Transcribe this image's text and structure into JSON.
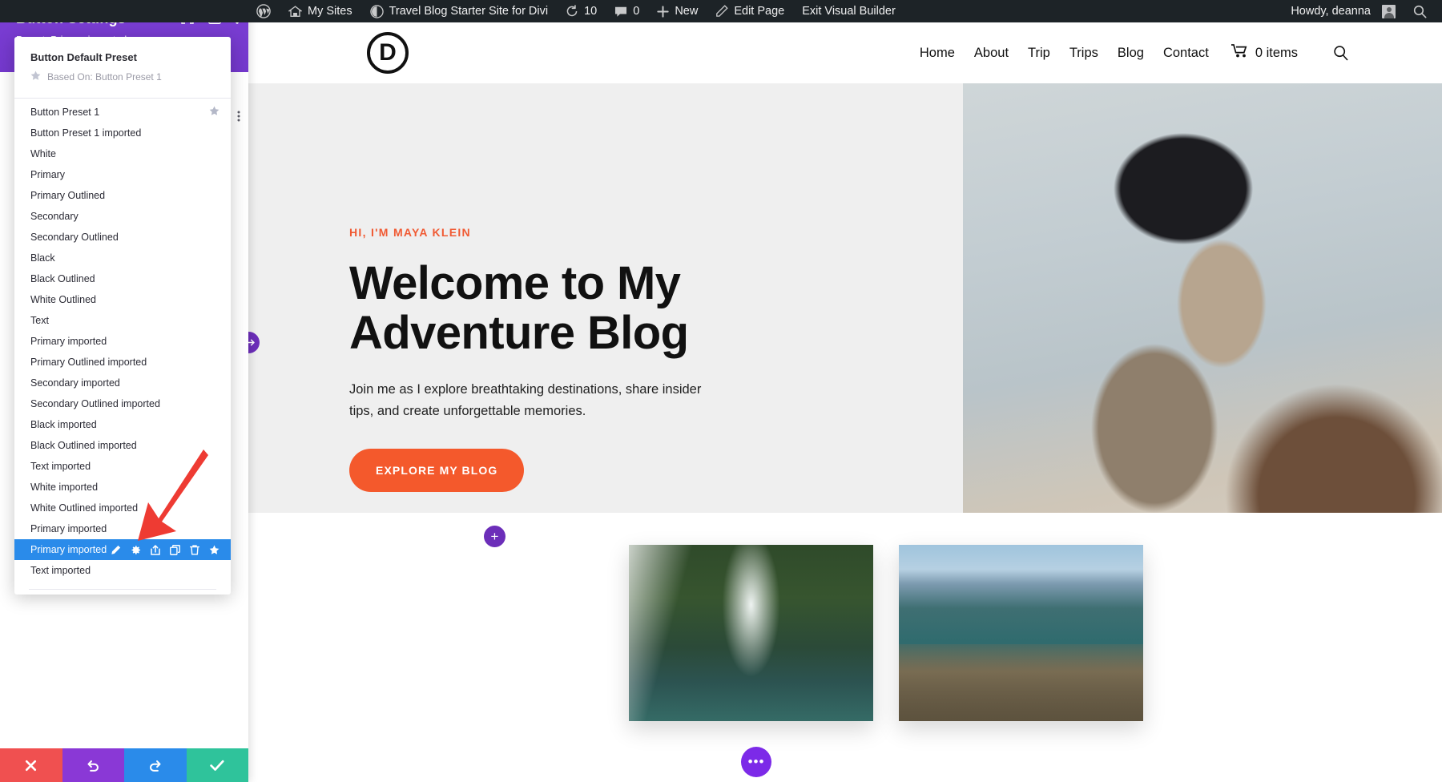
{
  "admin_bar": {
    "items": [
      {
        "name": "wp-logo",
        "label": "",
        "icon": "wordpress-icon"
      },
      {
        "name": "my-sites",
        "label": "My Sites",
        "icon": "sites-icon"
      },
      {
        "name": "site-name",
        "label": "Travel Blog Starter Site for Divi",
        "icon": "dashboard-icon"
      },
      {
        "name": "updates",
        "label": "10",
        "icon": "updates-icon"
      },
      {
        "name": "comments",
        "label": "0",
        "icon": "comment-icon"
      },
      {
        "name": "new-content",
        "label": "New",
        "icon": "plus-icon"
      },
      {
        "name": "edit-page",
        "label": "Edit Page",
        "icon": "pencil-icon"
      },
      {
        "name": "exit-visual-builder",
        "label": "Exit Visual Builder",
        "icon": ""
      }
    ],
    "howdy": "Howdy, deanna",
    "search_icon": "search-icon"
  },
  "builder": {
    "title": "Button Settings",
    "preset_label": "Preset: Primary imported",
    "header_icons": [
      "focus-icon",
      "layout-panel-icon",
      "more-vertical-icon"
    ],
    "footer": {
      "cancel": "cancel-icon",
      "undo": "undo-icon",
      "redo": "redo-icon",
      "save": "check-icon"
    },
    "accent_purple": "#7b3fd1",
    "accent_blue": "#2a8bea"
  },
  "preset_menu": {
    "default_title": "Button Default Preset",
    "default_sub": "Based On: Button Preset 1",
    "default_sub_icon": "star-icon",
    "items": [
      {
        "label": "Button Preset 1",
        "starred": true,
        "active": false
      },
      {
        "label": "Button Preset 1 imported",
        "starred": false,
        "active": false
      },
      {
        "label": "White",
        "starred": false,
        "active": false
      },
      {
        "label": "Primary",
        "starred": false,
        "active": false
      },
      {
        "label": "Primary Outlined",
        "starred": false,
        "active": false
      },
      {
        "label": "Secondary",
        "starred": false,
        "active": false
      },
      {
        "label": "Secondary Outlined",
        "starred": false,
        "active": false
      },
      {
        "label": "Black",
        "starred": false,
        "active": false
      },
      {
        "label": "Black Outlined",
        "starred": false,
        "active": false
      },
      {
        "label": "White Outlined",
        "starred": false,
        "active": false
      },
      {
        "label": "Text",
        "starred": false,
        "active": false
      },
      {
        "label": "Primary imported",
        "starred": false,
        "active": false
      },
      {
        "label": "Primary Outlined imported",
        "starred": false,
        "active": false
      },
      {
        "label": "Secondary imported",
        "starred": false,
        "active": false
      },
      {
        "label": "Secondary Outlined imported",
        "starred": false,
        "active": false
      },
      {
        "label": "Black imported",
        "starred": false,
        "active": false
      },
      {
        "label": "Black Outlined imported",
        "starred": false,
        "active": false
      },
      {
        "label": "Text imported",
        "starred": false,
        "active": false
      },
      {
        "label": "White imported",
        "starred": false,
        "active": false
      },
      {
        "label": "White Outlined imported",
        "starred": false,
        "active": false
      },
      {
        "label": "Primary imported",
        "starred": false,
        "active": false
      },
      {
        "label": "Primary imported",
        "starred": false,
        "active": true,
        "actions": [
          "edit-pencil-icon",
          "settings-gear-icon",
          "export-icon",
          "duplicate-icon",
          "delete-trash-icon",
          "star-icon"
        ]
      },
      {
        "label": "Text imported",
        "starred": false,
        "active": false
      }
    ]
  },
  "site": {
    "logo_letter": "D",
    "nav": [
      "Home",
      "About",
      "Trip",
      "Trips",
      "Blog",
      "Contact"
    ],
    "cart_label": "0 items",
    "cart_icon": "cart-icon",
    "search_icon": "search-icon",
    "hero": {
      "eyebrow": "HI, I'M MAYA KLEIN",
      "heading_line1": "Welcome to My",
      "heading_line2": "Adventure Blog",
      "paragraph": "Join me as I explore breathtaking destinations, share insider tips, and create unforgettable memories.",
      "button": "EXPLORE MY BLOG",
      "eyebrow_color": "#f05a33",
      "button_color": "#f4592c"
    },
    "fab_add": "+",
    "fab_more": "•••"
  }
}
